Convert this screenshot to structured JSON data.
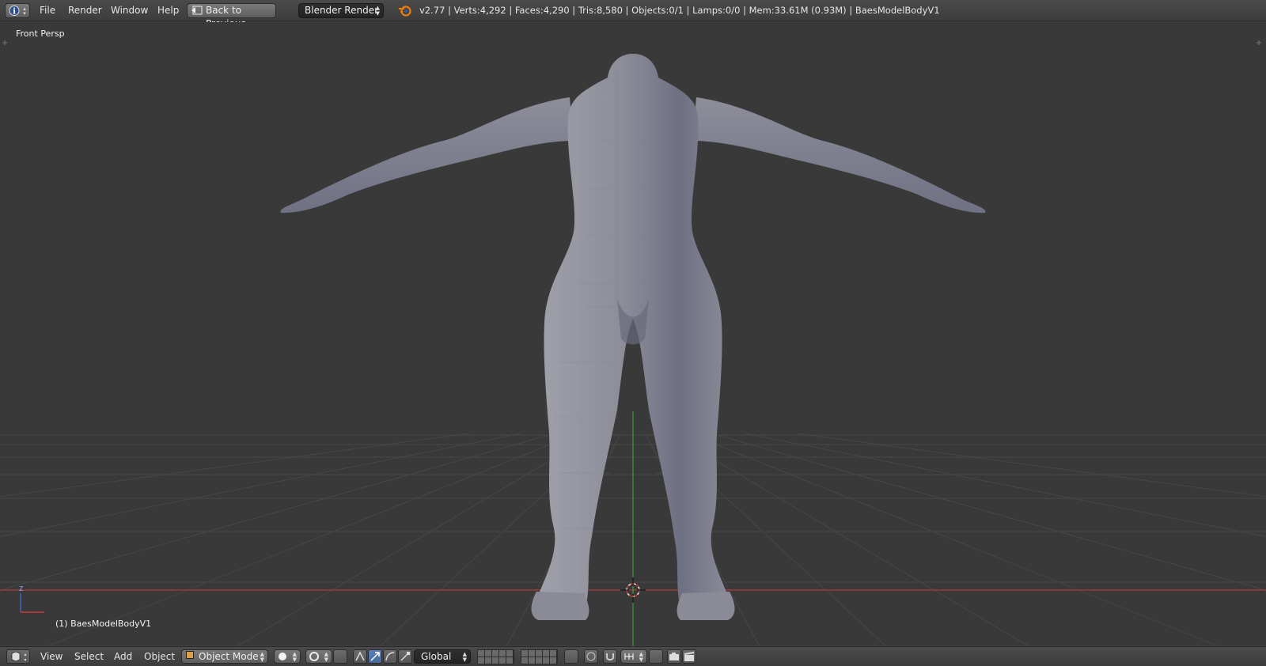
{
  "topbar": {
    "menu": [
      "File",
      "Render",
      "Window",
      "Help"
    ],
    "back_button": "Back to Previous",
    "render_engine": "Blender Render",
    "stats": "v2.77 | Verts:4,292 | Faces:4,290 | Tris:8,580 | Objects:0/1 | Lamps:0/0 | Mem:33.61M (0.93M) | BaesModelBodyV1"
  },
  "viewport": {
    "view_label": "Front Persp",
    "object_label": "(1) BaesModelBodyV1",
    "axis_z": "Z"
  },
  "bottombar": {
    "menu": [
      "View",
      "Select",
      "Add",
      "Object"
    ],
    "mode": "Object Mode",
    "orientation": "Global"
  },
  "colors": {
    "x_axis": "#c83a3a",
    "y_axis": "#3cb03c",
    "mesh": "#8e8f9c"
  }
}
